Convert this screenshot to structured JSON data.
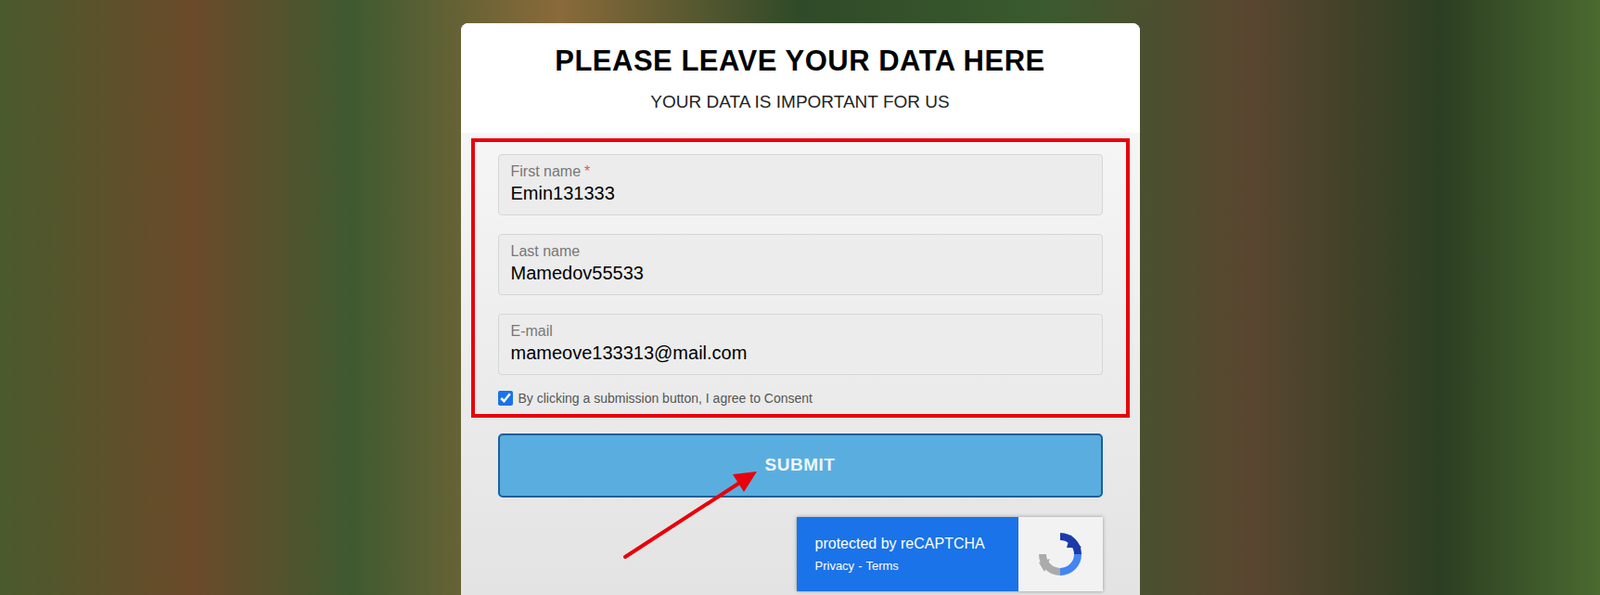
{
  "form": {
    "title": "PLEASE LEAVE YOUR DATA HERE",
    "subtitle": "YOUR DATA IS IMPORTANT FOR US",
    "required_mark": "*",
    "fields": [
      {
        "label": "First name",
        "required": true,
        "value": "Emin131333"
      },
      {
        "label": "Last name",
        "required": false,
        "value": "Mamedov55533"
      },
      {
        "label": "E-mail",
        "required": false,
        "value": "mameove133313@mail.com"
      }
    ],
    "consent": {
      "label": "By clicking a submission button, I agree to Consent",
      "checked": true
    },
    "submit": {
      "label": "SUBMIT"
    },
    "recaptcha": {
      "title": "protected by reCAPTCHA",
      "links": [
        "Privacy",
        "Terms"
      ],
      "separator": "-"
    }
  }
}
